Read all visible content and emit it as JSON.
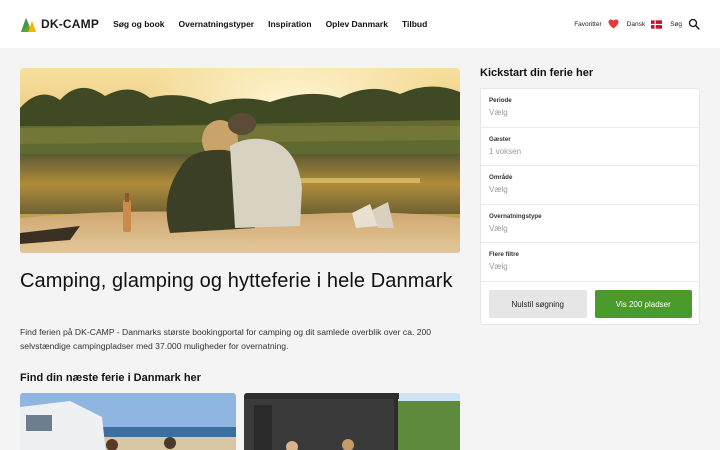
{
  "brand": {
    "name": "DK-CAMP"
  },
  "nav": [
    {
      "label": "Søg og book"
    },
    {
      "label": "Overnatningstyper"
    },
    {
      "label": "Inspiration"
    },
    {
      "label": "Oplev Danmark"
    },
    {
      "label": "Tilbud"
    }
  ],
  "header_right": {
    "favorites": "Favoritter",
    "language": "Dansk",
    "search": "Søg"
  },
  "main": {
    "heading": "Camping, glamping og hytteferie i hele Danmark",
    "lead": "Find ferien på DK-CAMP - Danmarks største bookingportal for camping og dit samlede overblik over ca. 200 selvstændige campingpladser med 37.000 muligheder for overnatning.",
    "section_heading": "Find din næste ferie i Danmark her"
  },
  "sidebar": {
    "title": "Kickstart din ferie her",
    "fields": [
      {
        "label": "Periode",
        "value": "Vælg"
      },
      {
        "label": "Gæster",
        "value": "1 voksen"
      },
      {
        "label": "Område",
        "value": "Vælg"
      },
      {
        "label": "Overnatningstype",
        "value": "Vælg"
      },
      {
        "label": "Flere filtre",
        "value": "Vælg"
      }
    ],
    "reset_label": "Nulstil søgning",
    "show_label": "Vis 200 pladser"
  },
  "colors": {
    "accent": "#4a9a2c",
    "heart": "#e53a3a",
    "flag": "#c8102e"
  },
  "icons": [
    "logo-icon",
    "heart-icon",
    "flag-icon",
    "search-icon"
  ]
}
